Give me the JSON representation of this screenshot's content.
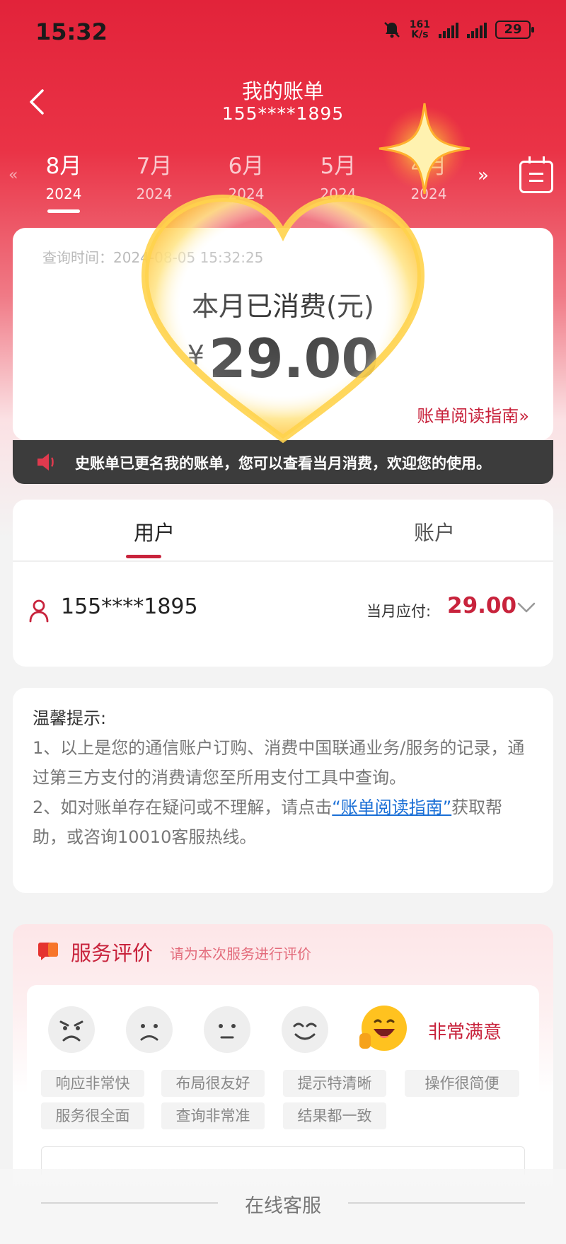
{
  "status_bar": {
    "time": "15:32",
    "net_speed_value": "161",
    "net_speed_unit": "K/s",
    "battery": "29"
  },
  "header": {
    "title": "我的账单",
    "subtitle": "155****1895"
  },
  "months": [
    {
      "month": "8月",
      "year": "2024",
      "active": true
    },
    {
      "month": "7月",
      "year": "2024",
      "active": false
    },
    {
      "month": "6月",
      "year": "2024",
      "active": false
    },
    {
      "month": "5月",
      "year": "2024",
      "active": false
    },
    {
      "month": "4月",
      "year": "2024",
      "active": false
    }
  ],
  "summary": {
    "query_time": "查询时间：2024-08-05 15:32:25",
    "spent_label": "本月已消费(元)",
    "currency": "¥",
    "amount": "29.00",
    "guide_link": "账单阅读指南",
    "guide_arrow": "»"
  },
  "notice": {
    "text": "史账单已更名我的账单，您可以查看当月消费，欢迎您的使用。"
  },
  "account": {
    "tabs": [
      "用户",
      "账户"
    ],
    "phone": "155****1895",
    "due_label": "当月应付:",
    "due_value": "29.00"
  },
  "tips": {
    "heading": "温馨提示:",
    "line1": "1、以上是您的通信账户订购、消费中国联通业务/服务的记录，通过第三方支付的消费请您至所用支付工具中查询。",
    "line2_before": "2、如对账单存在疑问或不理解，请点击",
    "line2_link": "“账单阅读指南”",
    "line2_after": "获取帮助，或咨询10010客服热线。"
  },
  "evaluation": {
    "title": "服务评价",
    "subtitle": "请为本次服务进行评价",
    "selected_label": "非常满意",
    "chips": [
      "响应非常快",
      "布局很友好",
      "提示特清晰",
      "操作很简便",
      "服务很全面",
      "查询非常准",
      "结果都一致"
    ]
  },
  "bottom": {
    "label": "在线客服"
  },
  "colors": {
    "brand_red": "#c8233c",
    "header_red": "#e2233a",
    "link_blue": "#1a6fd6"
  }
}
